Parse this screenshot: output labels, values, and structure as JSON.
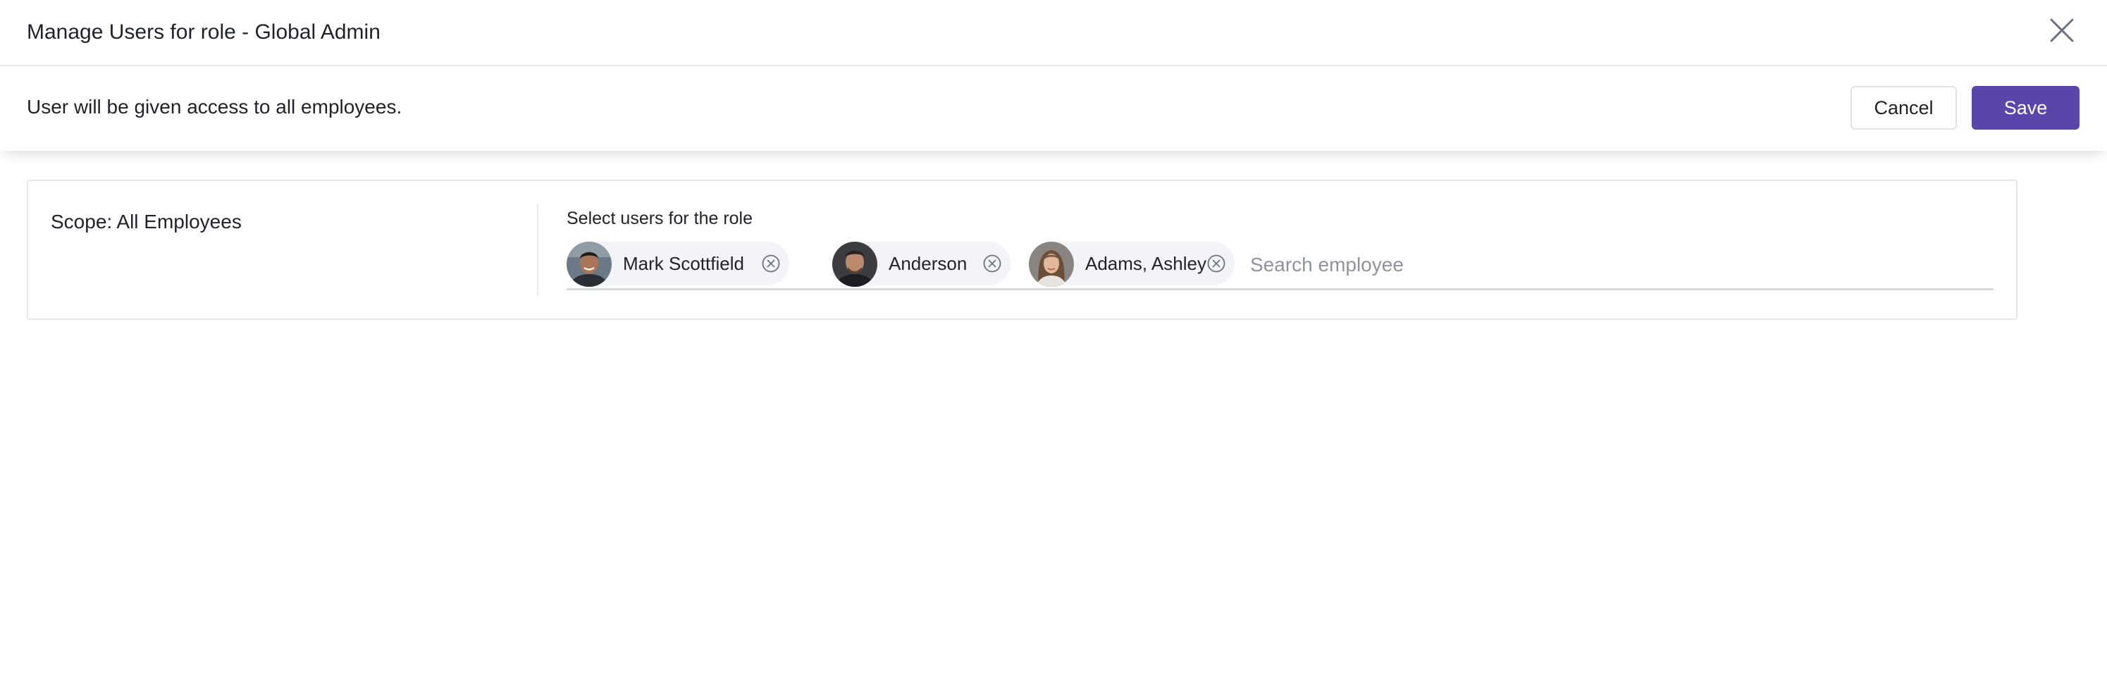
{
  "dialog": {
    "title": "Manage Users for role - Global Admin",
    "close_icon": "close-icon"
  },
  "subbar": {
    "message": "User will be given access to all employees.",
    "cancel_label": "Cancel",
    "save_label": "Save"
  },
  "scope": {
    "label": "Scope: All Employees"
  },
  "selector": {
    "label": "Select users for the role",
    "users": [
      {
        "name": "Mark Scottfield",
        "avatar_icon": "user-avatar",
        "remove_icon": "remove-circle-icon"
      },
      {
        "name": "Anderson",
        "avatar_icon": "user-avatar",
        "remove_icon": "remove-circle-icon"
      },
      {
        "name": "Adams, Ashley",
        "avatar_icon": "user-avatar",
        "remove_icon": "remove-circle-icon"
      }
    ],
    "search_placeholder": "Search employee",
    "search_value": ""
  },
  "colors": {
    "accent": "#5a45aa",
    "text": "#1f2329",
    "border": "#e4e6ea",
    "chip_bg": "#f3f4f7",
    "placeholder": "#8e939c"
  }
}
